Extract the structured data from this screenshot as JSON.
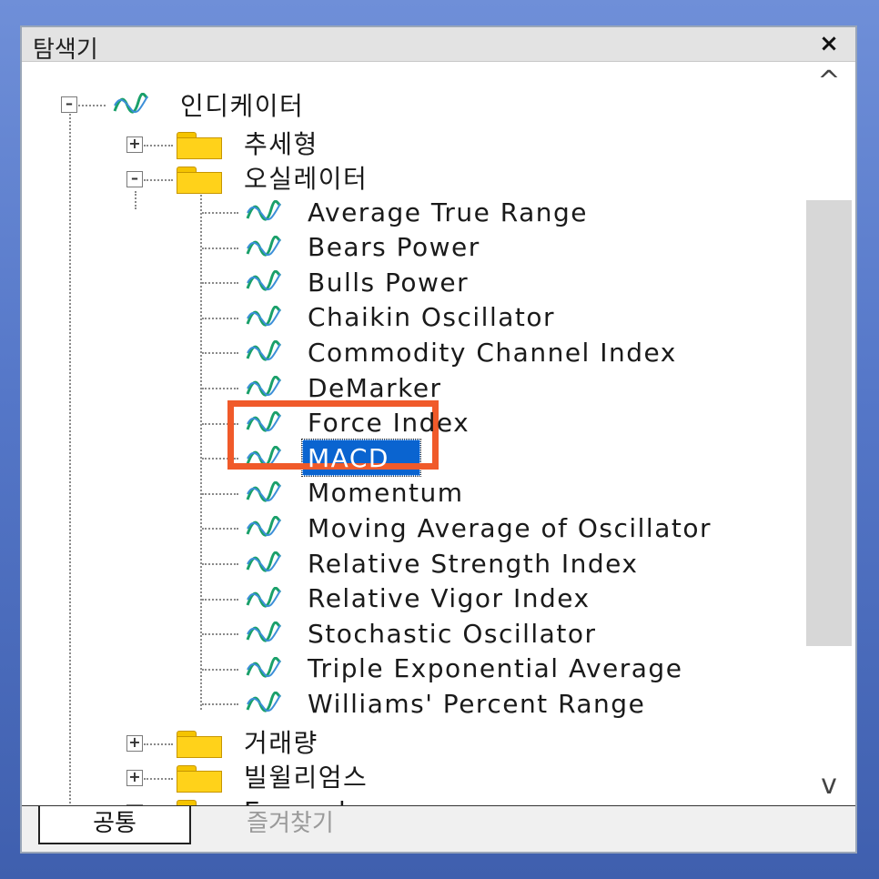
{
  "window": {
    "title": "탐색기",
    "close_label": "×"
  },
  "tree": {
    "root": {
      "label": "인디케이터",
      "expander": "–"
    },
    "folders": [
      {
        "label": "추세형",
        "expander": "+"
      },
      {
        "label": "오실레이터",
        "expander": "–"
      },
      {
        "label": "거래량",
        "expander": "+"
      },
      {
        "label": "빌윌리엄스",
        "expander": "+"
      },
      {
        "label": "Examples",
        "expander": "+"
      }
    ],
    "oscillators": [
      "Average True Range",
      "Bears Power",
      "Bulls Power",
      "Chaikin Oscillator",
      "Commodity Channel Index",
      "DeMarker",
      "Force Index",
      "MACD",
      "Momentum",
      "Moving Average of Oscillator",
      "Relative Strength Index",
      "Relative Vigor Index",
      "Stochastic Oscillator",
      "Triple Exponential Average",
      "Williams' Percent Range"
    ],
    "selected": "MACD"
  },
  "scrollbar": {
    "up": "^",
    "down": "v"
  },
  "tabs": [
    {
      "label": "공통",
      "active": true
    },
    {
      "label": "즐겨찾기",
      "active": false
    }
  ],
  "colors": {
    "selection": "#0a64d0",
    "highlight_box": "#f05a2a",
    "folder": "#ffd21a",
    "indicator_icon": "#1aa06a"
  }
}
